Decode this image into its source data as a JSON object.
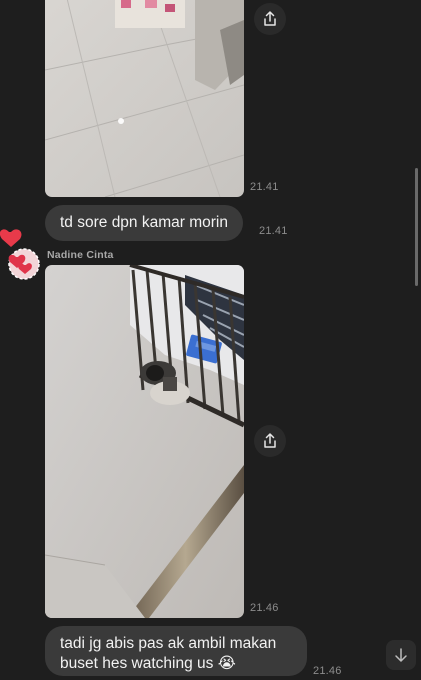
{
  "messages": {
    "photo_1": {
      "time": "21.41"
    },
    "text_1": {
      "text": "td sore dpn kamar morin",
      "time": "21.41"
    },
    "sender": {
      "name": "Nadine Cinta"
    },
    "photo_2": {
      "time": "21.46"
    },
    "text_2": {
      "text": "tadi jg abis pas ak ambil makan buset hes watching us 😭",
      "time": "21.46"
    }
  },
  "icons": {
    "share": "share-icon",
    "scroll_down": "arrow-down-icon",
    "avatar": "avatar"
  },
  "colors": {
    "background": "#1e1e1e",
    "bubble": "#3a3a3a",
    "text": "#f2f2f2",
    "timestamp": "#8c8c8c",
    "sender": "#a8a8a8"
  }
}
